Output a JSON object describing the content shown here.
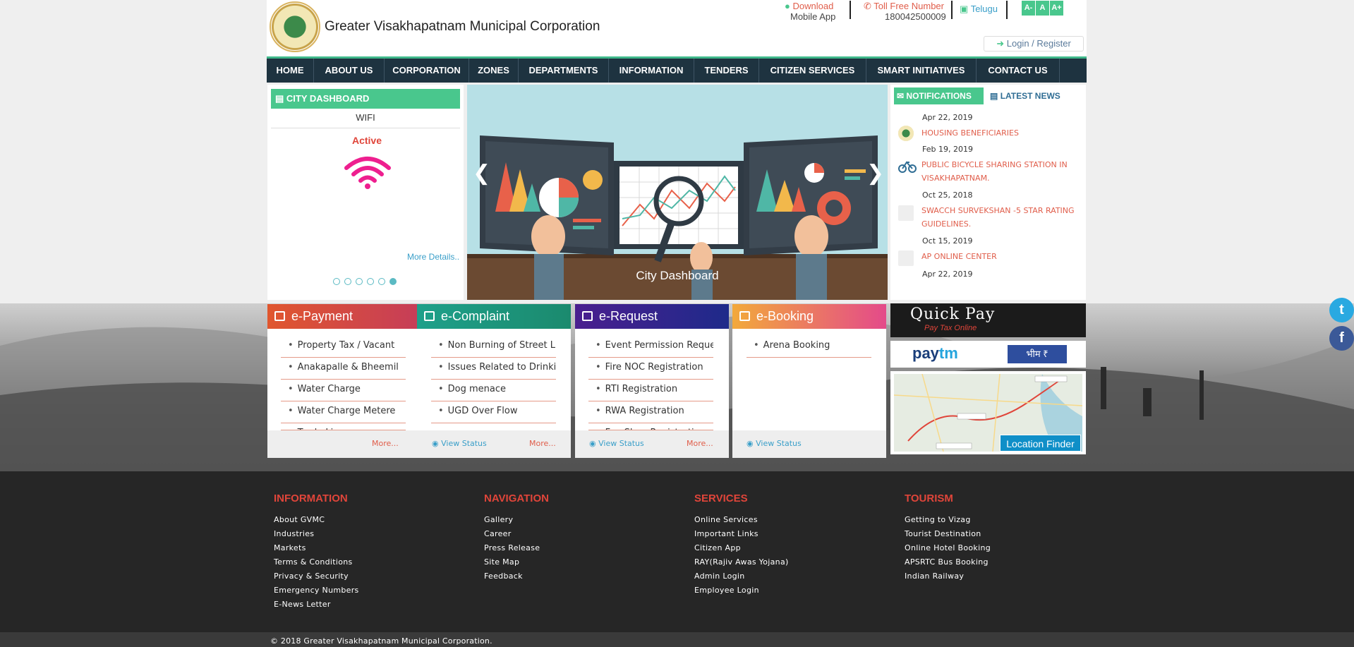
{
  "header": {
    "org_name": "Greater Visakhapatnam  Municipal Corporation",
    "download_label": "Download",
    "download_sub": "Mobile App",
    "toll_label": "Toll Free Number",
    "toll_number": "180042500009",
    "language_label": "Telugu",
    "font_size_buttons": [
      "A-",
      "A",
      "A+"
    ],
    "login_label": "Login / Register"
  },
  "nav": {
    "items": [
      "HOME",
      "ABOUT US",
      "CORPORATION",
      "ZONES",
      "DEPARTMENTS",
      "INFORMATION",
      "TENDERS",
      "CITIZEN SERVICES",
      "SMART INITIATIVES",
      "CONTACT US"
    ]
  },
  "city_dashboard": {
    "title": "CITY DASHBOARD",
    "item": "WIFI",
    "status": "Active",
    "more_label": "More Details..",
    "dots": 6,
    "active_dot": 6
  },
  "slider": {
    "caption": "City Dashboard",
    "prev_icon": "chevron-left-icon",
    "next_icon": "chevron-right-icon"
  },
  "notifications": {
    "tab_notifications": "NOTIFICATIONS",
    "tab_news": "LATEST NEWS",
    "items": [
      {
        "date": "Apr 22, 2019",
        "title": "HOUSING BENEFICIARIES"
      },
      {
        "date": "Feb 19, 2019",
        "title": "PUBLIC BICYCLE SHARING STATION IN VISAKHAPATNAM."
      },
      {
        "date": "Oct 25, 2018",
        "title": "SWACCH SURVEKSHAN -5 STAR RATING GUIDELINES."
      },
      {
        "date": "Oct 15, 2019",
        "title": "AP ONLINE CENTER"
      },
      {
        "date": "Apr 22, 2019",
        "title": ""
      }
    ]
  },
  "cards": [
    {
      "title": "e-Payment",
      "items": [
        "Property Tax / Vacant",
        "Anakapalle & Bheemil",
        "Water Charge",
        "Water Charge Metere",
        "Trade Li"
      ],
      "view_status": "",
      "more": "More..."
    },
    {
      "title": "e-Complaint",
      "items": [
        "Non Burning of Street L",
        "Issues Related to Drinki",
        "Dog menace",
        "UGD Over Flow"
      ],
      "view_status": "View Status",
      "more": "More..."
    },
    {
      "title": "e-Request",
      "items": [
        "Event Permission Reque",
        "Fire NOC Registration",
        "RTI Registration",
        "RWA Registration",
        "Fee Slum Registrati"
      ],
      "view_status": "View Status",
      "more": "More..."
    },
    {
      "title": "e-Booking",
      "items": [
        "Arena Booking"
      ],
      "view_status": "View Status",
      "more": ""
    }
  ],
  "widgets": {
    "quick_pay_title": "Quick Pay",
    "quick_pay_sub": "Pay Tax Online",
    "paytm_pay": "pay",
    "paytm_tm": "tm",
    "bhim_label": "भीम ₹",
    "location_finder": "Location Finder"
  },
  "social": {
    "twitter": "t",
    "facebook": "f"
  },
  "footer": {
    "columns": [
      {
        "heading": "INFORMATION",
        "links": [
          "About GVMC",
          "Industries",
          "Markets",
          "Terms & Conditions",
          "Privacy & Security",
          "Emergency Numbers",
          "E-News Letter"
        ]
      },
      {
        "heading": "NAVIGATION",
        "links": [
          "Gallery",
          "Career",
          "Press Release",
          "Site Map",
          "Feedback"
        ]
      },
      {
        "heading": "SERVICES",
        "links": [
          "Online Services",
          "Important Links",
          "Citizen App",
          "RAY(Rajiv Awas Yojana)",
          "Admin Login",
          "Employee Login"
        ]
      },
      {
        "heading": "TOURISM",
        "links": [
          "Getting to Vizag",
          "Tourist Destination",
          "Online Hotel Booking",
          "APSRTC Bus Booking",
          "Indian Railway"
        ]
      }
    ],
    "copyright": "© 2018 Greater Visakhapatnam Municipal Corporation."
  },
  "colors": {
    "accent_green": "#49c78d",
    "nav_bg": "#1e3340",
    "link_red": "#e05d4a",
    "epayment": "#e0562e",
    "ecomplaint": "#1ea08a",
    "erequest": "#3a1f8f",
    "ebooking": "#f2a93b"
  }
}
